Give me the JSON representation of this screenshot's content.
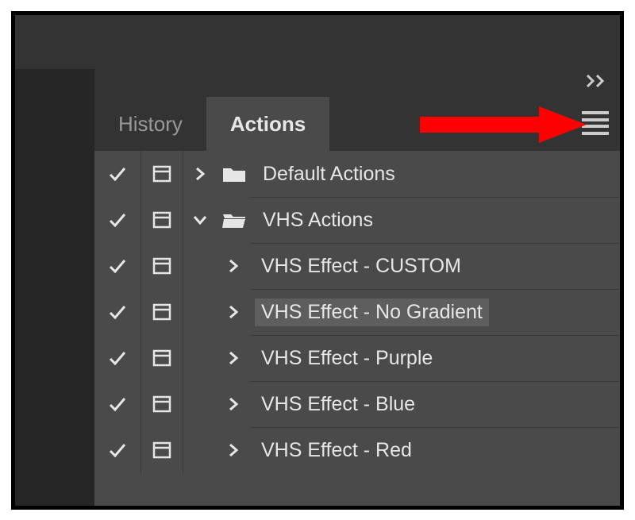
{
  "collapse_label": "Collapse",
  "tabs": {
    "history": "History",
    "actions": "Actions"
  },
  "menu_label": "Panel Menu",
  "rows": [
    {
      "label": "Default Actions",
      "checked": true,
      "dialog": true,
      "expanded": false,
      "isSet": true,
      "indent": 0,
      "folderOpen": false,
      "selected": false
    },
    {
      "label": "VHS Actions",
      "checked": true,
      "dialog": true,
      "expanded": true,
      "isSet": true,
      "indent": 0,
      "folderOpen": true,
      "selected": false
    },
    {
      "label": "VHS Effect - CUSTOM",
      "checked": true,
      "dialog": true,
      "expanded": false,
      "isSet": false,
      "indent": 1,
      "selected": false
    },
    {
      "label": "VHS Effect - No Gradient",
      "checked": true,
      "dialog": true,
      "expanded": false,
      "isSet": false,
      "indent": 1,
      "selected": true
    },
    {
      "label": "VHS Effect - Purple",
      "checked": true,
      "dialog": true,
      "expanded": false,
      "isSet": false,
      "indent": 1,
      "selected": false
    },
    {
      "label": "VHS Effect - Blue",
      "checked": true,
      "dialog": true,
      "expanded": false,
      "isSet": false,
      "indent": 1,
      "selected": false
    },
    {
      "label": "VHS Effect - Red",
      "checked": true,
      "dialog": true,
      "expanded": false,
      "isSet": false,
      "indent": 1,
      "selected": false
    }
  ]
}
